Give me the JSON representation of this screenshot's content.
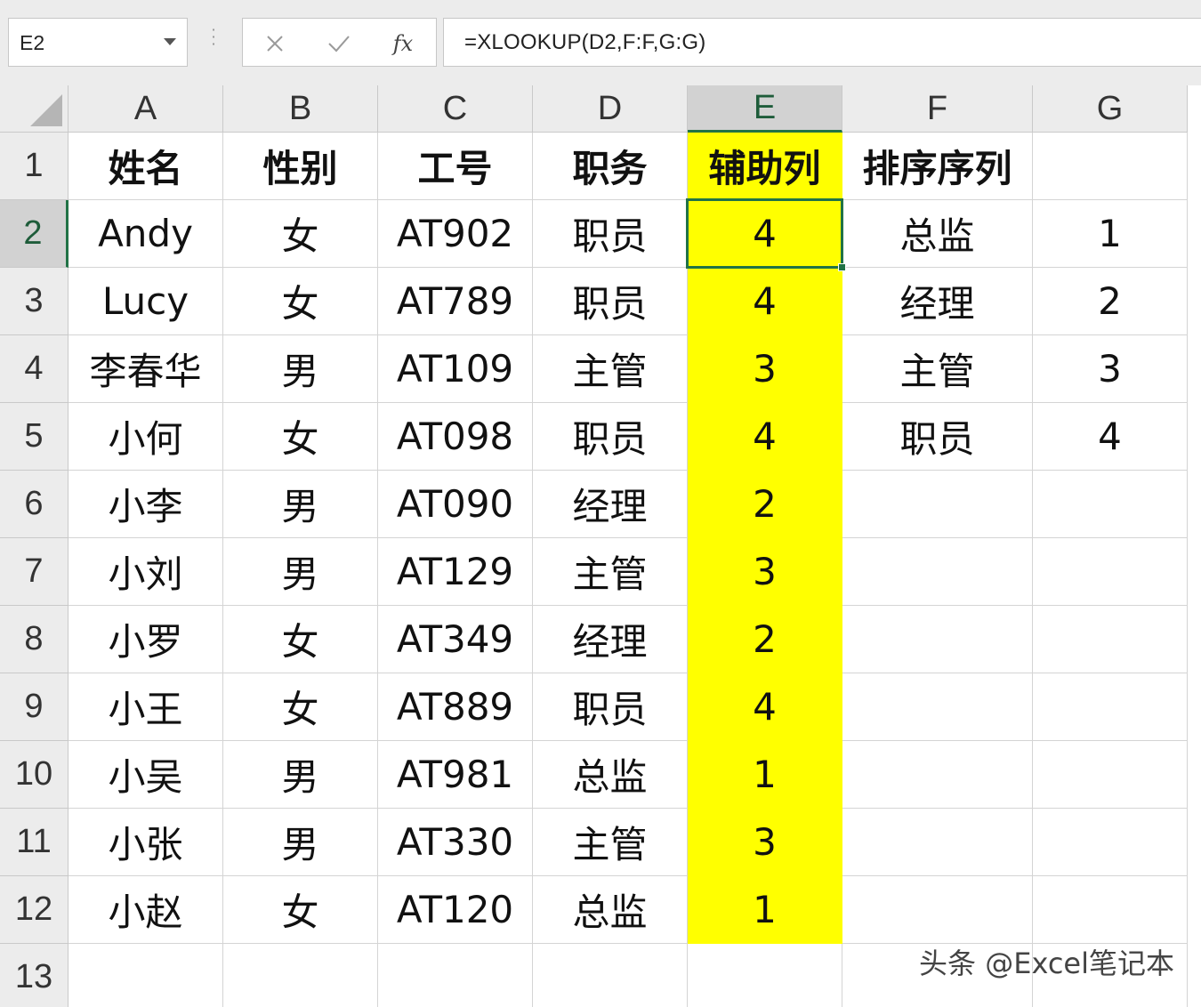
{
  "formula_bar": {
    "cell_reference": "E2",
    "cancel_icon": "close-icon",
    "enter_icon": "check-icon",
    "function_label": "fx",
    "formula": "=XLOOKUP(D2,F:F,G:G)"
  },
  "columns": [
    "A",
    "B",
    "C",
    "D",
    "E",
    "F",
    "G"
  ],
  "selected_column": "E",
  "selected_row": "2",
  "rows": [
    {
      "num": "1",
      "cells": [
        "姓名",
        "性别",
        "工号",
        "职务",
        "辅助列",
        "排序序列",
        ""
      ]
    },
    {
      "num": "2",
      "cells": [
        "Andy",
        "女",
        "AT902",
        "职员",
        "4",
        "总监",
        "1"
      ]
    },
    {
      "num": "3",
      "cells": [
        "Lucy",
        "女",
        "AT789",
        "职员",
        "4",
        "经理",
        "2"
      ]
    },
    {
      "num": "4",
      "cells": [
        "李春华",
        "男",
        "AT109",
        "主管",
        "3",
        "主管",
        "3"
      ]
    },
    {
      "num": "5",
      "cells": [
        "小何",
        "女",
        "AT098",
        "职员",
        "4",
        "职员",
        "4"
      ]
    },
    {
      "num": "6",
      "cells": [
        "小李",
        "男",
        "AT090",
        "经理",
        "2",
        "",
        ""
      ]
    },
    {
      "num": "7",
      "cells": [
        "小刘",
        "男",
        "AT129",
        "主管",
        "3",
        "",
        ""
      ]
    },
    {
      "num": "8",
      "cells": [
        "小罗",
        "女",
        "AT349",
        "经理",
        "2",
        "",
        ""
      ]
    },
    {
      "num": "9",
      "cells": [
        "小王",
        "女",
        "AT889",
        "职员",
        "4",
        "",
        ""
      ]
    },
    {
      "num": "10",
      "cells": [
        "小吴",
        "男",
        "AT981",
        "总监",
        "1",
        "",
        ""
      ]
    },
    {
      "num": "11",
      "cells": [
        "小张",
        "男",
        "AT330",
        "主管",
        "3",
        "",
        ""
      ]
    },
    {
      "num": "12",
      "cells": [
        "小赵",
        "女",
        "AT120",
        "总监",
        "1",
        "",
        ""
      ]
    },
    {
      "num": "13",
      "cells": [
        "",
        "",
        "",
        "",
        "",
        "",
        ""
      ]
    }
  ],
  "highlight_color": "#ffff00",
  "accent_color": "#217346",
  "watermark": "头条 @Excel笔记本"
}
